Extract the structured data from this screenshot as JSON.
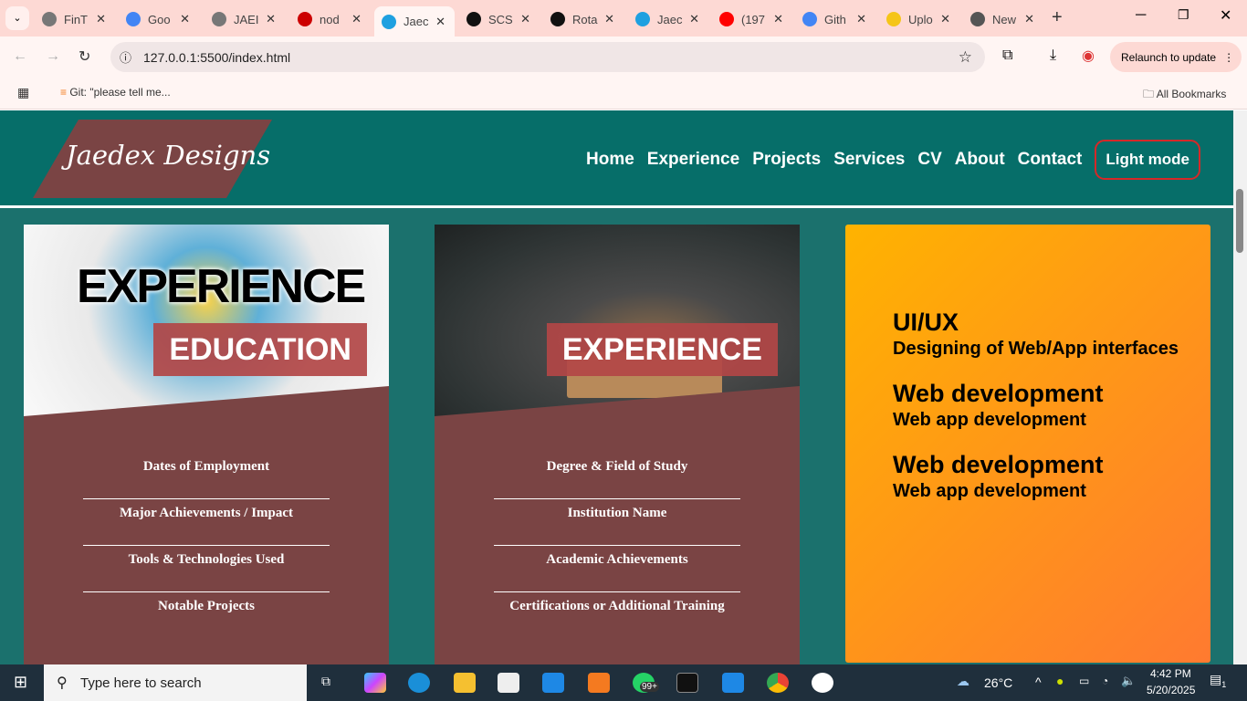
{
  "browser": {
    "tabs": [
      {
        "label": "FinT",
        "color": "#777"
      },
      {
        "label": "Goo",
        "color": "#4285f4"
      },
      {
        "label": "JAEI",
        "color": "#777"
      },
      {
        "label": "nod",
        "color": "#c00"
      },
      {
        "label": "Jaec",
        "color": "#1ea0e0",
        "active": true
      },
      {
        "label": "SCS",
        "color": "#111"
      },
      {
        "label": "Rota",
        "color": "#111"
      },
      {
        "label": "Jaec",
        "color": "#1ea0e0"
      },
      {
        "label": "(197",
        "color": "#f00"
      },
      {
        "label": "Gith",
        "color": "#4285f4"
      },
      {
        "label": "Uplo",
        "color": "#f5c518"
      },
      {
        "label": "New",
        "color": "#555"
      }
    ],
    "url": "127.0.0.1:5500/index.html",
    "relaunch": "Relaunch to update",
    "bookmark": "Git: \"please tell me...",
    "all_bookmarks": "All Bookmarks"
  },
  "site": {
    "logo": "Jaedex Designs",
    "nav": [
      "Home",
      "Experience",
      "Projects",
      "Services",
      "CV",
      "About",
      "Contact"
    ],
    "mode_button": "Light mode",
    "colors": {
      "header": "#066e69",
      "card": "#7a4444",
      "accent": "#d62828"
    },
    "cards": [
      {
        "image_text": "EXPERIENCE",
        "tag": "EDUCATION",
        "items": [
          "Dates of Employment",
          "Major Achievements / Impact",
          "Tools & Technologies Used",
          "Notable Projects"
        ]
      },
      {
        "tag": "EXPERIENCE",
        "items": [
          "Degree & Field of Study",
          "Institution Name",
          "Academic Achievements",
          "Certifications or Additional Training"
        ]
      }
    ],
    "services": [
      {
        "title": "UI/UX",
        "desc": "Designing of Web/App interfaces"
      },
      {
        "title": "Web development",
        "desc": "Web app development"
      },
      {
        "title": "Web development",
        "desc": "Web app development"
      }
    ]
  },
  "taskbar": {
    "search": "Type here to search",
    "weather": "26°C",
    "time": "4:42 PM",
    "date": "5/20/2025",
    "badge": "99+",
    "notifications": "1"
  }
}
